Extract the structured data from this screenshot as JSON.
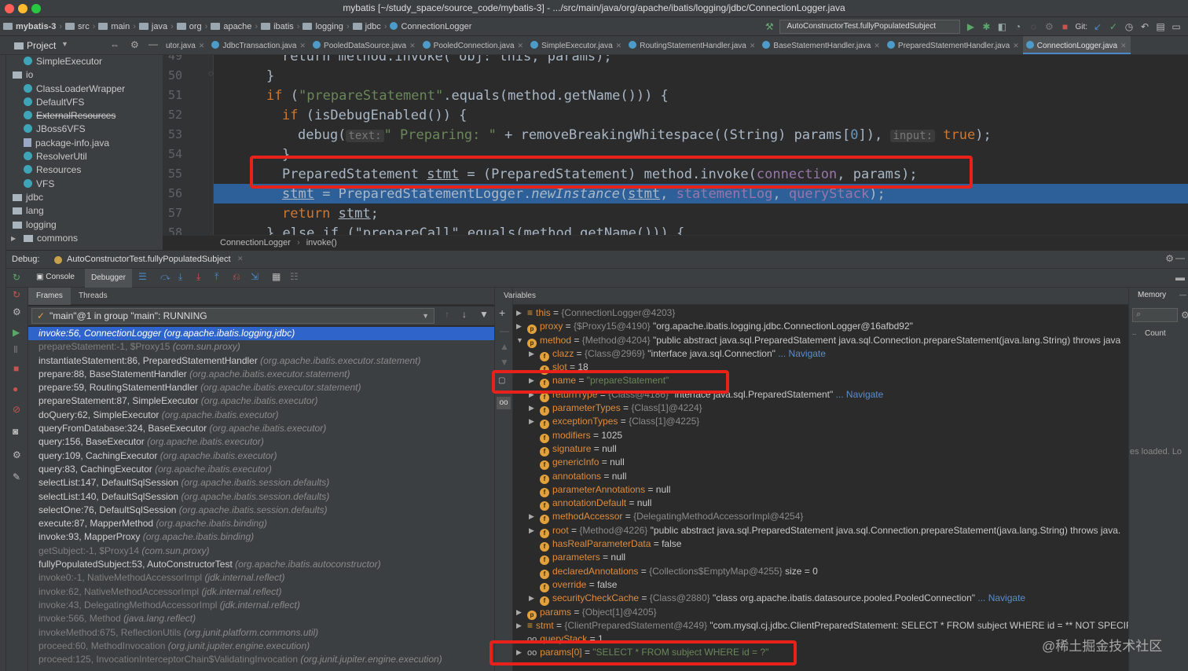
{
  "window": {
    "title": "mybatis [~/study_space/source_code/mybatis-3] - .../src/main/java/org/apache/ibatis/logging/jdbc/ConnectionLogger.java"
  },
  "breadcrumbs": [
    "mybatis-3",
    "src",
    "main",
    "java",
    "org",
    "apache",
    "ibatis",
    "logging",
    "jdbc",
    "ConnectionLogger"
  ],
  "run_config": "AutoConstructorTest.fullyPopulatedSubject",
  "git_label": "Git:",
  "project_label": "Project",
  "editor_tabs": [
    "utor.java",
    "JdbcTransaction.java",
    "PooledDataSource.java",
    "PooledConnection.java",
    "SimpleExecutor.java",
    "RoutingStatementHandler.java",
    "BaseStatementHandler.java",
    "PreparedStatementHandler.java",
    "ConnectionLogger.java"
  ],
  "tree": [
    {
      "label": "SimpleExecutor",
      "kind": "class",
      "indent": 22
    },
    {
      "label": "io",
      "kind": "package",
      "indent": 8
    },
    {
      "label": "ClassLoaderWrapper",
      "kind": "class",
      "indent": 22
    },
    {
      "label": "DefaultVFS",
      "kind": "class",
      "indent": 22
    },
    {
      "label": "ExternalResources",
      "kind": "class",
      "indent": 22
    },
    {
      "label": "JBoss6VFS",
      "kind": "class",
      "indent": 22
    },
    {
      "label": "package-info.java",
      "kind": "file",
      "indent": 22
    },
    {
      "label": "ResolverUtil",
      "kind": "class",
      "indent": 22
    },
    {
      "label": "Resources",
      "kind": "class",
      "indent": 22
    },
    {
      "label": "VFS",
      "kind": "class",
      "indent": 22
    },
    {
      "label": "jdbc",
      "kind": "package",
      "indent": 8
    },
    {
      "label": "lang",
      "kind": "package",
      "indent": 8
    },
    {
      "label": "logging",
      "kind": "package",
      "indent": 8
    },
    {
      "label": "commons",
      "kind": "package",
      "indent": 22
    }
  ],
  "code": {
    "line_numbers": [
      "49",
      "50",
      "51",
      "52",
      "53",
      "54",
      "55",
      "56",
      "57",
      "58"
    ],
    "l49": "return method.invoke( obj: this, params);",
    "l50": "}",
    "l51_kw": "if",
    "l51_a": " (",
    "l51_str": "\"prepareStatement\"",
    "l51_b": ".equals(method.getName())) {",
    "l52_kw": "if",
    "l52_b": " (isDebugEnabled()) {",
    "l53_a": "debug(",
    "l53_hint1": "text:",
    "l53_str": "\" Preparing: \"",
    "l53_b": " + removeBreakingWhitespace((String) params[",
    "l53_num": "0",
    "l53_c": "]),",
    "l53_hint2": "input:",
    "l53_kw": "true",
    "l53_d": ");",
    "l54": "}",
    "l55_a": "PreparedStatement ",
    "l55_var": "stmt",
    "l55_b": " = (PreparedStatement) method.invoke(",
    "l55_fld": "connection",
    "l55_c": ", params);",
    "l56_var": "stmt",
    "l56_a": " = PreparedStatementLogger.",
    "l56_it": "newInstance",
    "l56_b": "(",
    "l56_var2": "stmt",
    "l56_c": ", ",
    "l56_fld1": "statementLog",
    "l56_d": ", ",
    "l56_fld2": "queryStack",
    "l56_e": ");",
    "l57_kw": "return",
    "l57_var": "stmt",
    "l57_end": ";",
    "l58": "} else if (\"prepareCall\".equals(method.getName())) {"
  },
  "editor_crumbs": [
    "ConnectionLogger",
    "invoke()"
  ],
  "debug": {
    "label": "Debug:",
    "session": "AutoConstructorTest.fullyPopulatedSubject",
    "tab_console": "Console",
    "tab_debugger": "Debugger",
    "frames_tab": "Frames",
    "threads_tab": "Threads",
    "thread": "\"main\"@1 in group \"main\": RUNNING",
    "variables_label": "Variables",
    "memory_label": "Memory",
    "count_label": "Count",
    "classes_loaded": "es loaded. Lo"
  },
  "frames": [
    {
      "m": "invoke:56, ConnectionLogger",
      "p": "(org.apache.ibatis.logging.jdbc)",
      "s": "sel"
    },
    {
      "m": "prepareStatement:-1, $Proxy15",
      "p": "(com.sun.proxy)",
      "s": "lib"
    },
    {
      "m": "instantiateStatement:86, PreparedStatementHandler",
      "p": "(org.apache.ibatis.executor.statement)",
      "s": ""
    },
    {
      "m": "prepare:88, BaseStatementHandler",
      "p": "(org.apache.ibatis.executor.statement)",
      "s": ""
    },
    {
      "m": "prepare:59, RoutingStatementHandler",
      "p": "(org.apache.ibatis.executor.statement)",
      "s": ""
    },
    {
      "m": "prepareStatement:87, SimpleExecutor",
      "p": "(org.apache.ibatis.executor)",
      "s": ""
    },
    {
      "m": "doQuery:62, SimpleExecutor",
      "p": "(org.apache.ibatis.executor)",
      "s": ""
    },
    {
      "m": "queryFromDatabase:324, BaseExecutor",
      "p": "(org.apache.ibatis.executor)",
      "s": ""
    },
    {
      "m": "query:156, BaseExecutor",
      "p": "(org.apache.ibatis.executor)",
      "s": ""
    },
    {
      "m": "query:109, CachingExecutor",
      "p": "(org.apache.ibatis.executor)",
      "s": ""
    },
    {
      "m": "query:83, CachingExecutor",
      "p": "(org.apache.ibatis.executor)",
      "s": ""
    },
    {
      "m": "selectList:147, DefaultSqlSession",
      "p": "(org.apache.ibatis.session.defaults)",
      "s": ""
    },
    {
      "m": "selectList:140, DefaultSqlSession",
      "p": "(org.apache.ibatis.session.defaults)",
      "s": ""
    },
    {
      "m": "selectOne:76, DefaultSqlSession",
      "p": "(org.apache.ibatis.session.defaults)",
      "s": ""
    },
    {
      "m": "execute:87, MapperMethod",
      "p": "(org.apache.ibatis.binding)",
      "s": ""
    },
    {
      "m": "invoke:93, MapperProxy",
      "p": "(org.apache.ibatis.binding)",
      "s": ""
    },
    {
      "m": "getSubject:-1, $Proxy14",
      "p": "(com.sun.proxy)",
      "s": "lib"
    },
    {
      "m": "fullyPopulatedSubject:53, AutoConstructorTest",
      "p": "(org.apache.ibatis.autoconstructor)",
      "s": ""
    },
    {
      "m": "invoke0:-1, NativeMethodAccessorImpl",
      "p": "(jdk.internal.reflect)",
      "s": "lib"
    },
    {
      "m": "invoke:62, NativeMethodAccessorImpl",
      "p": "(jdk.internal.reflect)",
      "s": "lib"
    },
    {
      "m": "invoke:43, DelegatingMethodAccessorImpl",
      "p": "(jdk.internal.reflect)",
      "s": "lib"
    },
    {
      "m": "invoke:566, Method",
      "p": "(java.lang.reflect)",
      "s": "lib"
    },
    {
      "m": "invokeMethod:675, ReflectionUtils",
      "p": "(org.junit.platform.commons.util)",
      "s": "lib"
    },
    {
      "m": "proceed:60, MethodInvocation",
      "p": "(org.junit.jupiter.engine.execution)",
      "s": "lib"
    },
    {
      "m": "proceed:125, InvocationInterceptorChain$ValidatingInvocation",
      "p": "(org.junit.jupiter.engine.execution)",
      "s": "lib"
    }
  ],
  "variables": [
    {
      "ind": 0,
      "exp": "▶",
      "icon": "≡",
      "name": "this",
      "eq": " = ",
      "type": "{ConnectionLogger@4203}",
      "val": "",
      "nav": ""
    },
    {
      "ind": 0,
      "exp": "▶",
      "icon": "p",
      "name": "proxy",
      "eq": " = ",
      "type": "{$Proxy15@4190}",
      "val": " \"org.apache.ibatis.logging.jdbc.ConnectionLogger@16afbd92\"",
      "nav": ""
    },
    {
      "ind": 0,
      "exp": "▼",
      "icon": "p",
      "name": "method",
      "eq": " = ",
      "type": "{Method@4204}",
      "val": " \"public abstract java.sql.PreparedStatement java.sql.Connection.prepareStatement(java.lang.String) throws java",
      "nav": ""
    },
    {
      "ind": 1,
      "exp": "▶",
      "icon": "f",
      "name": "clazz",
      "eq": " = ",
      "type": "{Class@2969}",
      "val": " \"interface java.sql.Connection\"",
      "nav": " ... Navigate"
    },
    {
      "ind": 1,
      "exp": "",
      "icon": "f",
      "name": "slot",
      "eq": " = ",
      "type": "",
      "val": "18",
      "nav": ""
    },
    {
      "ind": 1,
      "exp": "▶",
      "icon": "f",
      "name": "name",
      "eq": " = ",
      "type": "",
      "str": "\"prepareStatement\"",
      "val": "",
      "nav": ""
    },
    {
      "ind": 1,
      "exp": "▶",
      "icon": "f",
      "name": "returnType",
      "eq": " = ",
      "type": "{Class@4186}",
      "val": " \"interface java.sql.PreparedStatement\"",
      "nav": " ... Navigate"
    },
    {
      "ind": 1,
      "exp": "▶",
      "icon": "f",
      "name": "parameterTypes",
      "eq": " = ",
      "type": "{Class[1]@4224}",
      "val": "",
      "nav": ""
    },
    {
      "ind": 1,
      "exp": "▶",
      "icon": "f",
      "name": "exceptionTypes",
      "eq": " = ",
      "type": "{Class[1]@4225}",
      "val": "",
      "nav": ""
    },
    {
      "ind": 1,
      "exp": "",
      "icon": "f",
      "name": "modifiers",
      "eq": " = ",
      "type": "",
      "val": "1025",
      "nav": ""
    },
    {
      "ind": 1,
      "exp": "",
      "icon": "f",
      "name": "signature",
      "eq": " = ",
      "type": "",
      "val": "null",
      "nav": ""
    },
    {
      "ind": 1,
      "exp": "",
      "icon": "f",
      "name": "genericInfo",
      "eq": " = ",
      "type": "",
      "val": "null",
      "nav": ""
    },
    {
      "ind": 1,
      "exp": "",
      "icon": "f",
      "name": "annotations",
      "eq": " = ",
      "type": "",
      "val": "null",
      "nav": ""
    },
    {
      "ind": 1,
      "exp": "",
      "icon": "f",
      "name": "parameterAnnotations",
      "eq": " = ",
      "type": "",
      "val": "null",
      "nav": ""
    },
    {
      "ind": 1,
      "exp": "",
      "icon": "f",
      "name": "annotationDefault",
      "eq": " = ",
      "type": "",
      "val": "null",
      "nav": ""
    },
    {
      "ind": 1,
      "exp": "▶",
      "icon": "f",
      "name": "methodAccessor",
      "eq": " = ",
      "type": "{DelegatingMethodAccessorImpl@4254}",
      "val": "",
      "nav": ""
    },
    {
      "ind": 1,
      "exp": "▶",
      "icon": "f",
      "name": "root",
      "eq": " = ",
      "type": "{Method@4226}",
      "val": " \"public abstract java.sql.PreparedStatement java.sql.Connection.prepareStatement(java.lang.String) throws java.",
      "nav": ""
    },
    {
      "ind": 1,
      "exp": "",
      "icon": "f",
      "name": "hasRealParameterData",
      "eq": " = ",
      "type": "",
      "val": "false",
      "nav": ""
    },
    {
      "ind": 1,
      "exp": "",
      "icon": "f",
      "name": "parameters",
      "eq": " = ",
      "type": "",
      "val": "null",
      "nav": ""
    },
    {
      "ind": 1,
      "exp": "",
      "icon": "f",
      "name": "declaredAnnotations",
      "eq": " = ",
      "type": "{Collections$EmptyMap@4255}",
      "val": "  size = 0",
      "nav": ""
    },
    {
      "ind": 1,
      "exp": "",
      "icon": "f",
      "name": "override",
      "eq": " = ",
      "type": "",
      "val": "false",
      "nav": ""
    },
    {
      "ind": 1,
      "exp": "▶",
      "icon": "f",
      "name": "securityCheckCache",
      "eq": " = ",
      "type": "{Class@2880}",
      "val": " \"class org.apache.ibatis.datasource.pooled.PooledConnection\"",
      "nav": " ... Navigate"
    },
    {
      "ind": 0,
      "exp": "▶",
      "icon": "p",
      "name": "params",
      "eq": " = ",
      "type": "{Object[1]@4205}",
      "val": "",
      "nav": ""
    },
    {
      "ind": 0,
      "exp": "▶",
      "icon": "≡",
      "name": "stmt",
      "eq": " = ",
      "type": "{ClientPreparedStatement@4249}",
      "val": " \"com.mysql.cj.jdbc.ClientPreparedStatement: SELECT * FROM subject WHERE id = ** NOT SPECIF",
      "nav": ""
    },
    {
      "ind": 0,
      "exp": "",
      "icon": "∞",
      "name": "queryStack",
      "eq": " = ",
      "type": "",
      "val": "1",
      "nav": ""
    },
    {
      "ind": 0,
      "exp": "▶",
      "icon": "∞",
      "name": "params[0]",
      "eq": " = ",
      "type": "",
      "str": "\"SELECT * FROM subject WHERE id = ?\"",
      "val": "",
      "nav": ""
    }
  ],
  "watermark": "@稀土掘金技术社区",
  "colors": {
    "accent": "#2f65ca",
    "highlight_box": "#e8221b",
    "exec_line": "#2d6099"
  }
}
